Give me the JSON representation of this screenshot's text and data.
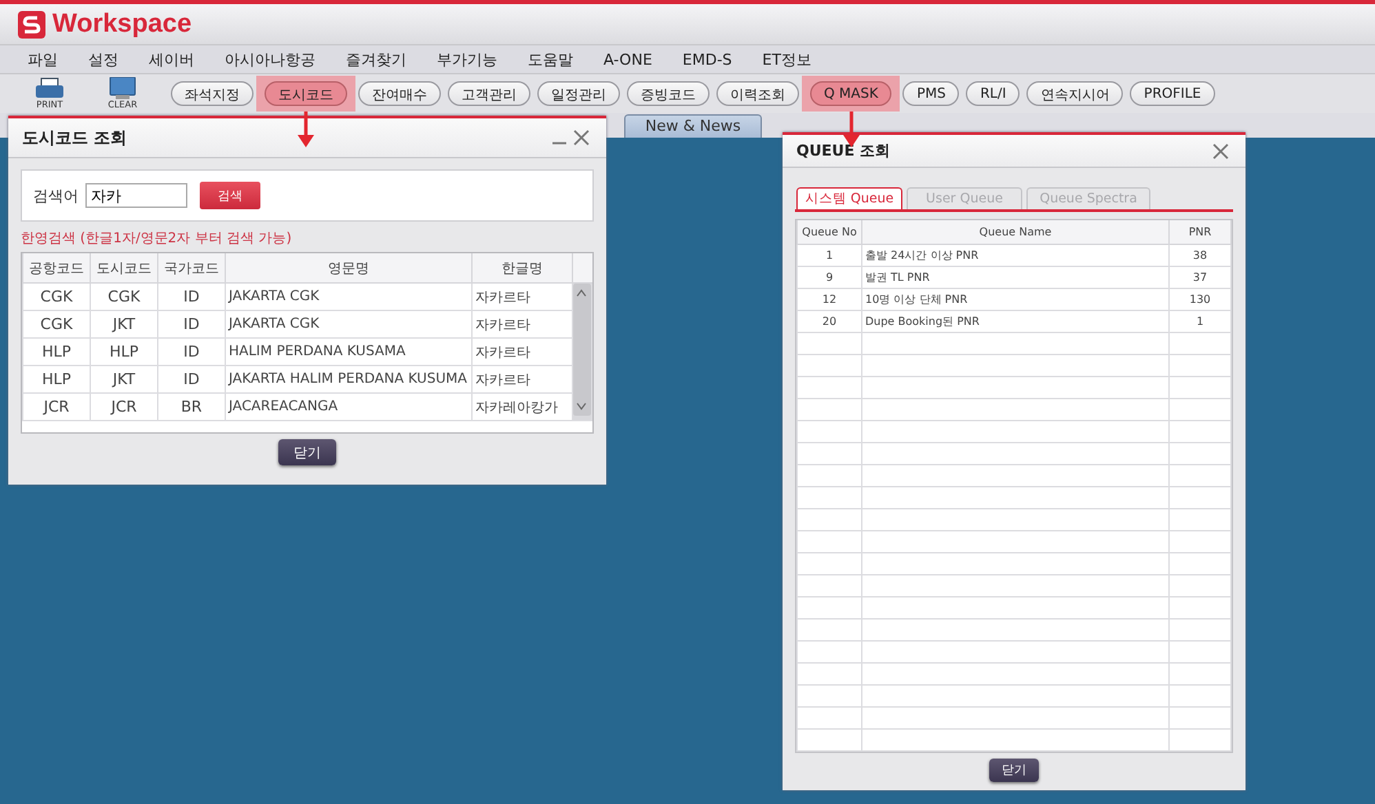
{
  "app": {
    "title": "Workspace"
  },
  "menu": [
    "파일",
    "설정",
    "세이버",
    "아시아나항공",
    "즐겨찾기",
    "부가기능",
    "도움말",
    "A-ONE",
    "EMD-S",
    "ET정보"
  ],
  "toolbar": {
    "icon_buttons": [
      {
        "label": "PRINT",
        "kind": "printer"
      },
      {
        "label": "CLEAR",
        "kind": "monitor"
      }
    ],
    "buttons": [
      {
        "label": "좌석지정",
        "highlighted": false
      },
      {
        "label": "도시코드",
        "highlighted": true
      },
      {
        "label": "잔여매수",
        "highlighted": false
      },
      {
        "label": "고객관리",
        "highlighted": false
      },
      {
        "label": "일정관리",
        "highlighted": false
      },
      {
        "label": "증빙코드",
        "highlighted": false
      },
      {
        "label": "이력조회",
        "highlighted": false
      },
      {
        "label": "Q MASK",
        "highlighted": true
      },
      {
        "label": "PMS",
        "highlighted": false
      },
      {
        "label": "RL/I",
        "highlighted": false
      },
      {
        "label": "연속지시어",
        "highlighted": false
      },
      {
        "label": "PROFILE",
        "highlighted": false
      }
    ]
  },
  "tabs": [
    {
      "label": "New & News",
      "selected": false
    }
  ],
  "city_dialog": {
    "title": "도시코드 조회",
    "search_label": "검색어",
    "search_value": "자카",
    "search_button": "검색",
    "hint": "한영검색 (한글1자/영문2자 부터 검색 가능)",
    "columns": [
      "공항코드",
      "도시코드",
      "국가코드",
      "영문명",
      "한글명"
    ],
    "rows": [
      [
        "CGK",
        "CGK",
        "ID",
        "JAKARTA CGK",
        "자카르타"
      ],
      [
        "CGK",
        "JKT",
        "ID",
        "JAKARTA CGK",
        "자카르타"
      ],
      [
        "HLP",
        "HLP",
        "ID",
        "HALIM PERDANA KUSAMA",
        "자카르타"
      ],
      [
        "HLP",
        "JKT",
        "ID",
        "JAKARTA HALIM PERDANA KUSUMA",
        "자카르타"
      ],
      [
        "JCR",
        "JCR",
        "BR",
        "JACAREACANGA",
        "자카레아캉가"
      ]
    ],
    "close_button": "닫기"
  },
  "queue_dialog": {
    "title": "QUEUE 조회",
    "tabs": [
      {
        "label": "시스템 Queue",
        "selected": true
      },
      {
        "label": "User Queue",
        "selected": false
      },
      {
        "label": "Queue Spectra",
        "selected": false
      }
    ],
    "columns": [
      "Queue No",
      "Queue Name",
      "PNR"
    ],
    "rows": [
      [
        "1",
        "출발 24시간 이상 PNR",
        "38"
      ],
      [
        "9",
        "발권 TL PNR",
        "37"
      ],
      [
        "12",
        "10명 이상 단체 PNR",
        "130"
      ],
      [
        "20",
        "Dupe Booking된 PNR",
        "1"
      ]
    ],
    "close_button": "닫기"
  }
}
